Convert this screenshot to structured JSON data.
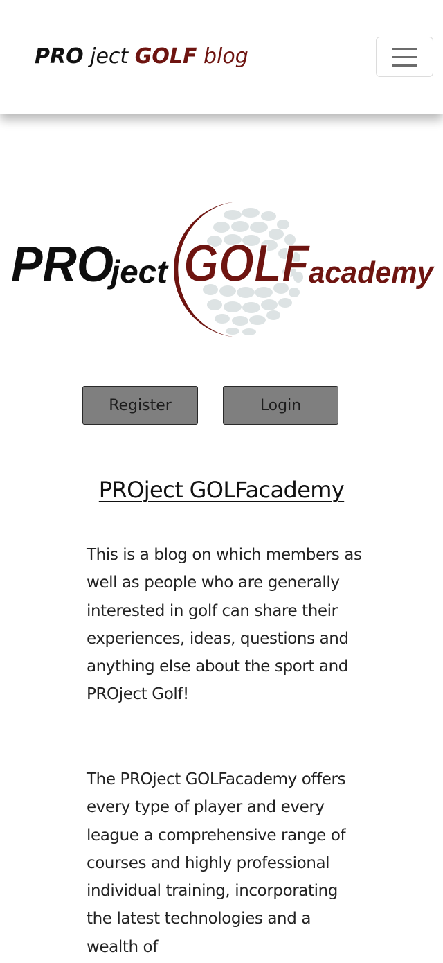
{
  "navbar": {
    "brand": {
      "part1": "PRO",
      "part2": " ject ",
      "part3": "GOLF",
      "part4": " blog"
    },
    "toggler_icon": "hamburger-menu-icon"
  },
  "logo": {
    "text_pro": "PRO",
    "text_ject": "ject",
    "text_golf": "GOLF",
    "text_academy": "academy",
    "icon": "golf-ball-icon",
    "colors": {
      "black": "#0d0d0d",
      "brand_red": "#6e1410",
      "ball": "#dde3e4"
    }
  },
  "actions": {
    "register_label": "Register",
    "login_label": "Login"
  },
  "content": {
    "heading": "PROject GOLFacademy",
    "paragraph1": "This is a blog on which members as well as people who are generally interested in golf can share their experiences, ideas, questions and anything else about the sport and PROject Golf!",
    "paragraph2": "The PROject GOLFacademy offers every type of player and every league a comprehensive range of courses and highly professional individual training, incorporating the latest technologies and a wealth of"
  },
  "colors": {
    "button_bg": "#7f7f7f",
    "brand_red": "#6e1410",
    "text": "#222222"
  }
}
